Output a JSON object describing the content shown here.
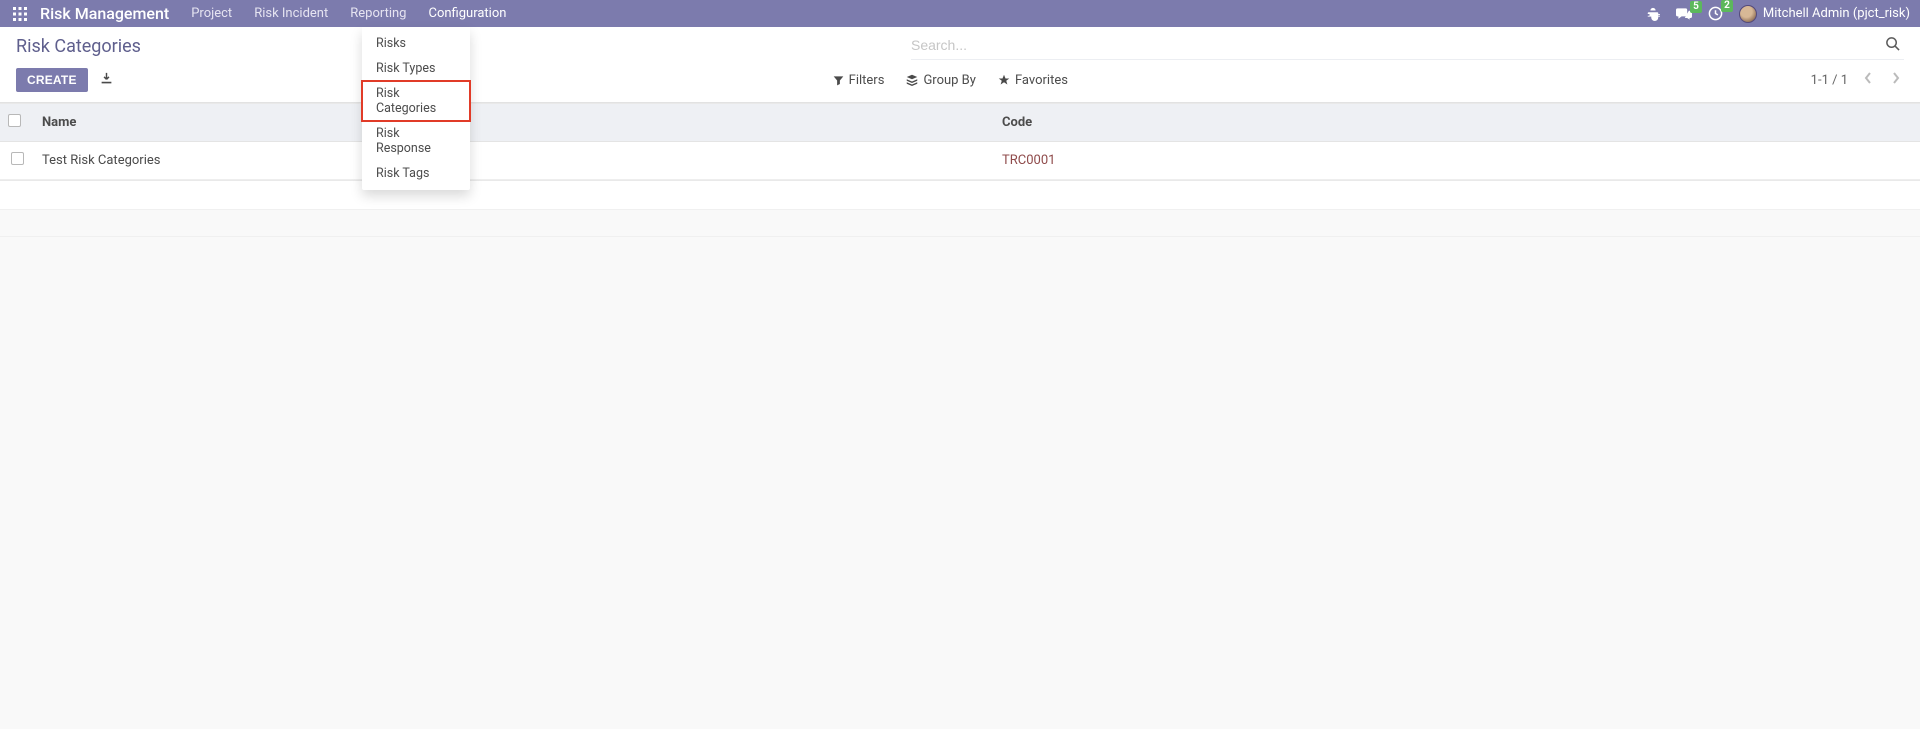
{
  "brand": "Risk Management",
  "nav": {
    "project": "Project",
    "incident": "Risk Incident",
    "reporting": "Reporting",
    "configuration": "Configuration"
  },
  "topbar": {
    "msg_badge": "5",
    "clock_badge": "2",
    "user_label": "Mitchell Admin (pjct_risk)"
  },
  "dropdown": {
    "risks": "Risks",
    "risk_types": "Risk Types",
    "risk_categories": "Risk Categories",
    "risk_response": "Risk Response",
    "risk_tags": "Risk Tags"
  },
  "breadcrumb": "Risk Categories",
  "buttons": {
    "create": "CREATE"
  },
  "search": {
    "placeholder": "Search..."
  },
  "filters": {
    "filters": "Filters",
    "groupby": "Group By",
    "favorites": "Favorites"
  },
  "pager": {
    "text": "1-1 / 1"
  },
  "table": {
    "headers": {
      "name": "Name",
      "code": "Code"
    },
    "rows": [
      {
        "name": "Test Risk Categories",
        "code": "TRC0001"
      }
    ]
  }
}
